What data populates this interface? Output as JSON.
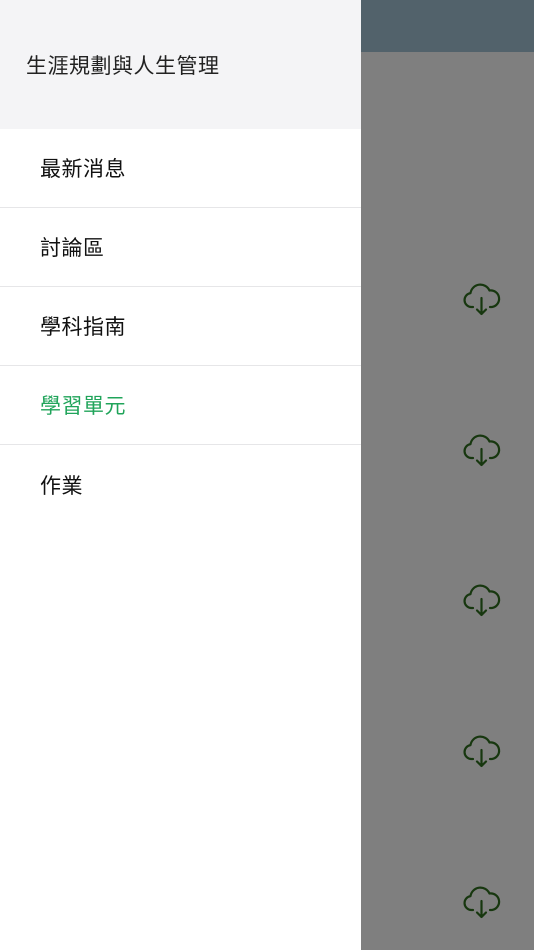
{
  "drawer": {
    "title": "生涯規劃與人生管理",
    "items": [
      {
        "label": "最新消息",
        "active": false
      },
      {
        "label": "討論區",
        "active": false
      },
      {
        "label": "學科指南",
        "active": false
      },
      {
        "label": "學習單元",
        "active": true
      },
      {
        "label": "作業",
        "active": false
      }
    ]
  },
  "background": {
    "header_color": "#a5c4d6",
    "overlay_color": "rgba(0,0,0,0.5)",
    "download_icons": [
      "cloud-download-icon",
      "cloud-download-icon",
      "cloud-download-icon",
      "cloud-download-icon",
      "cloud-download-icon"
    ]
  },
  "colors": {
    "accent": "#20a45a",
    "icon_green": "#2f6f1f",
    "drawer_header_bg": "#f4f4f6"
  }
}
